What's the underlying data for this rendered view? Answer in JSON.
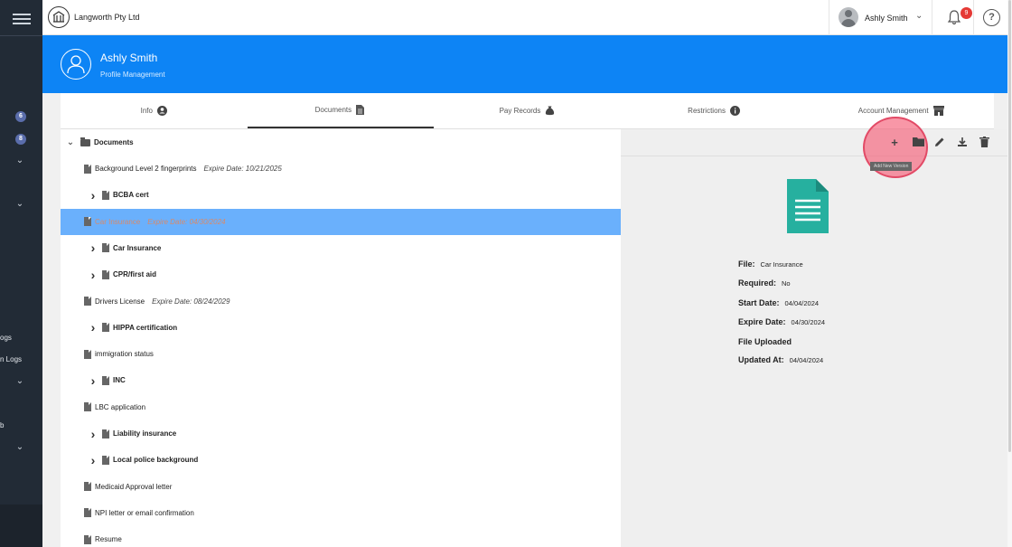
{
  "header": {
    "company": "Langworth Pty Ltd",
    "user_name": "Ashly Smith",
    "notification_count": "9",
    "help": "?"
  },
  "sidebar": {
    "badges": [
      "6",
      "8"
    ],
    "cut_labels": [
      "ogs",
      "n Logs",
      "b"
    ]
  },
  "profile": {
    "name": "Ashly Smith",
    "subtitle": "Profile Management"
  },
  "tabs": [
    {
      "label": "Info",
      "icon": "person-circle-icon"
    },
    {
      "label": "Documents",
      "icon": "document-icon",
      "active": true
    },
    {
      "label": "Pay Records",
      "icon": "money-bag-icon"
    },
    {
      "label": "Restrictions",
      "icon": "info-icon"
    },
    {
      "label": "Account Management",
      "icon": "store-icon"
    }
  ],
  "tree": {
    "root": "Documents",
    "items": [
      {
        "label": "Background Level 2 fingerprints",
        "expire": "Expire Date: 10/21/2025",
        "folder": false
      },
      {
        "label": "BCBA cert",
        "expire": "",
        "folder": true
      },
      {
        "label": "Car Insurance",
        "expire": "Expire Date: 04/30/2024",
        "folder": false,
        "selected": true
      },
      {
        "label": "Car Insurance",
        "expire": "",
        "folder": true
      },
      {
        "label": "CPR/first aid",
        "expire": "",
        "folder": true
      },
      {
        "label": "Drivers License",
        "expire": "Expire Date: 08/24/2029",
        "folder": false
      },
      {
        "label": "HIPPA certification",
        "expire": "",
        "folder": true
      },
      {
        "label": "immigration status",
        "expire": "",
        "folder": false
      },
      {
        "label": "INC",
        "expire": "",
        "folder": true
      },
      {
        "label": "LBC application",
        "expire": "",
        "folder": false
      },
      {
        "label": "Liability insurance",
        "expire": "",
        "folder": true
      },
      {
        "label": "Local police background",
        "expire": "",
        "folder": true
      },
      {
        "label": "Medicaid Approval letter",
        "expire": "",
        "folder": false
      },
      {
        "label": "NPI letter or email confirmation",
        "expire": "",
        "folder": false
      },
      {
        "label": "Resume",
        "expire": "",
        "folder": false
      }
    ]
  },
  "detail": {
    "tooltip": "Add New Version",
    "fields": [
      {
        "key": "File:",
        "value": "Car Insurance"
      },
      {
        "key": "Required:",
        "value": "No"
      },
      {
        "key": "Start Date:",
        "value": "04/04/2024"
      },
      {
        "key": "Expire Date:",
        "value": "04/30/2024"
      },
      {
        "key": "File Uploaded",
        "value": ""
      },
      {
        "key": "Updated At:",
        "value": "04/04/2024"
      }
    ]
  },
  "colors": {
    "banner": "#0d84f5",
    "selected_row": "#6ab0fc",
    "doc_icon_teal": "#26b09f",
    "highlight": "#e24a66"
  }
}
